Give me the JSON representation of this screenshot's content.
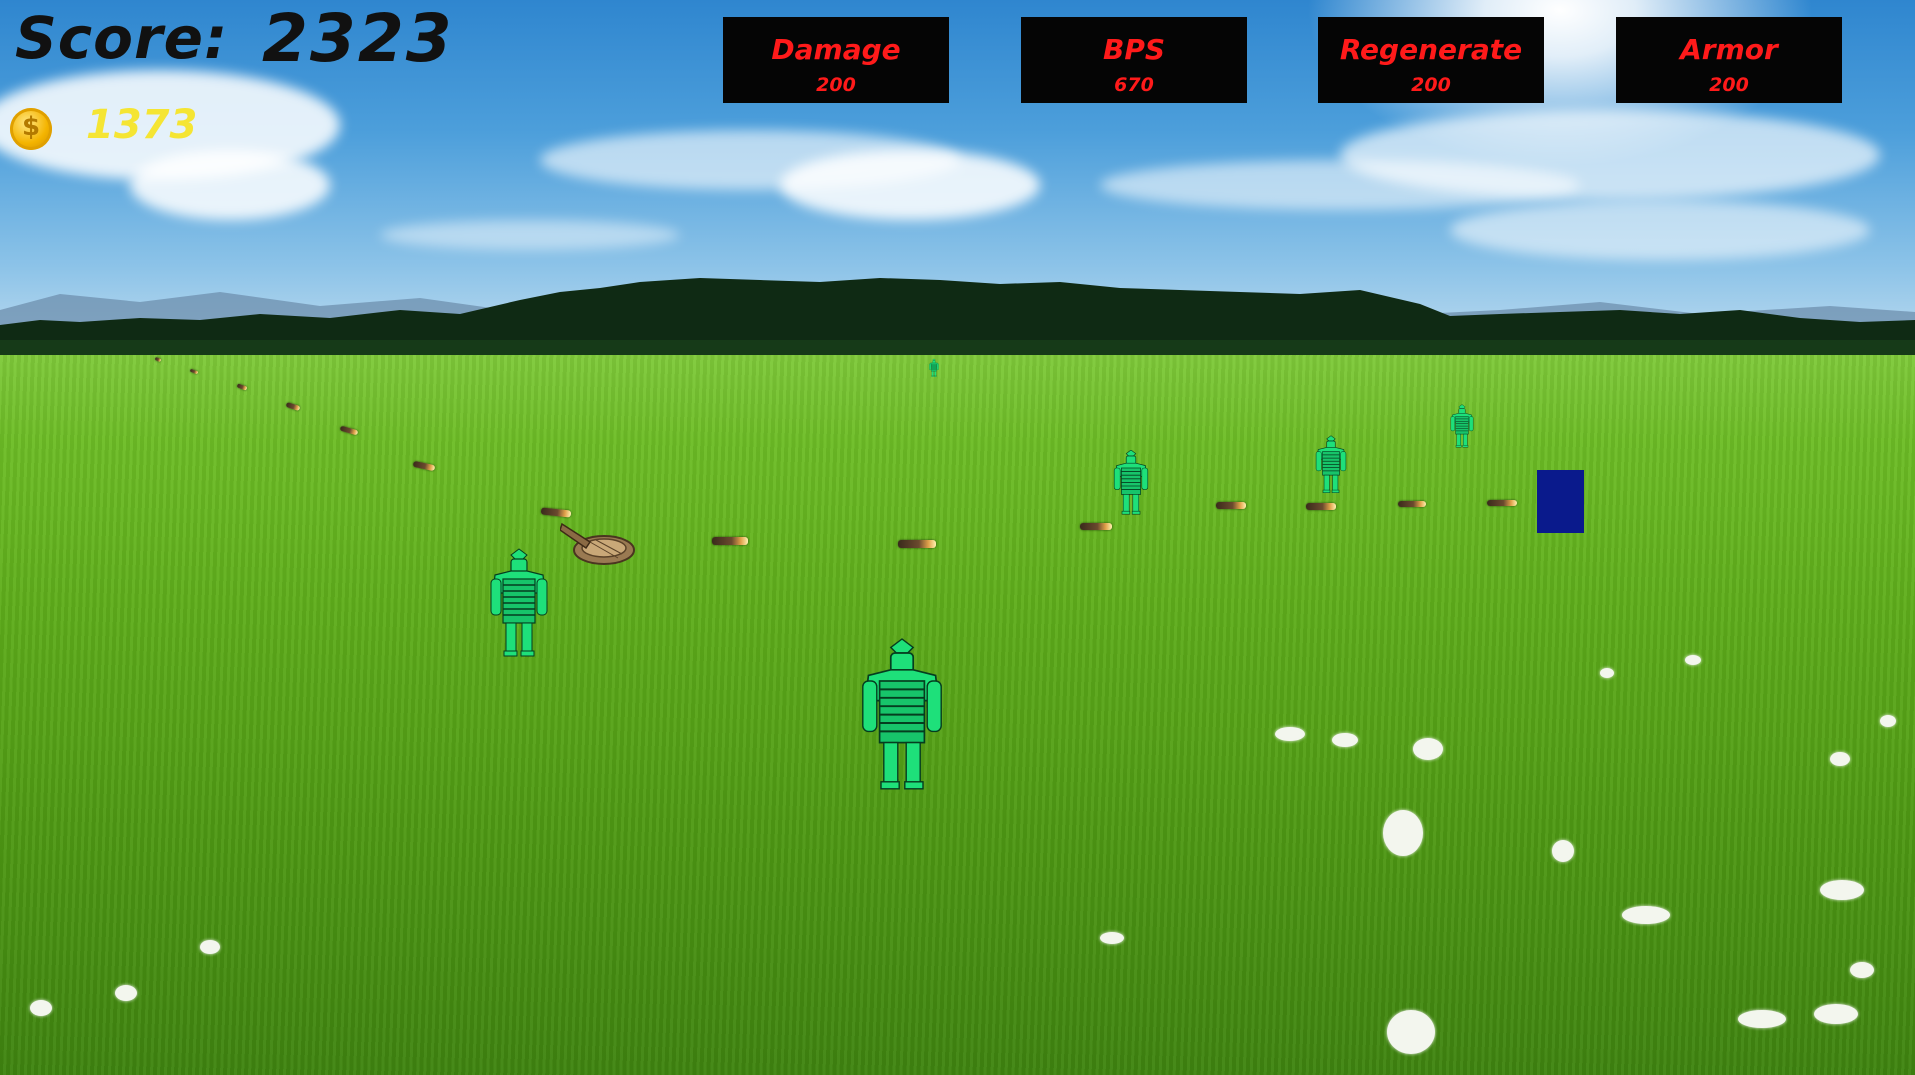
{
  "hud": {
    "score_label": "Score:",
    "score_value": "2323",
    "coins_icon": "coin-icon",
    "coins_value": "1373",
    "coin_symbol": "$"
  },
  "upgrades": [
    {
      "name": "Damage",
      "cost": "200"
    },
    {
      "name": "BPS",
      "cost": "670"
    },
    {
      "name": "Regenerate",
      "cost": "200"
    },
    {
      "name": "Armor",
      "cost": "200"
    }
  ],
  "colors": {
    "upgrade_bg": "#050505",
    "upgrade_text": "#ff1a1a",
    "coin_text": "#f5e533",
    "enemy": "#1ee07a",
    "player": "#0a1a8c"
  },
  "entities": {
    "enemy_icon": "samurai-enemy-icon",
    "enemy_count": 6,
    "bullet_count": 14,
    "turret_icon": "turret-icon",
    "player_icon": "player-block"
  }
}
